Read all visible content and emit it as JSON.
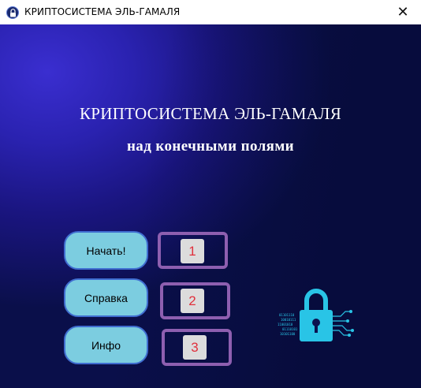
{
  "window": {
    "title": "КРИПТОСИСТЕМА ЭЛЬ-ГАМАЛЯ",
    "close_glyph": "✕",
    "icon": "lock-app-icon"
  },
  "header": {
    "title": "КРИПТОСИСТЕМА ЭЛЬ-ГАМАЛЯ",
    "subtitle": "над конечными полями"
  },
  "menu": {
    "buttons": [
      {
        "label": "Начать!",
        "step": "1"
      },
      {
        "label": "Справка",
        "step": "2"
      },
      {
        "label": "Инфо",
        "step": "3"
      }
    ]
  },
  "decoration": {
    "icon": "digital-padlock-icon",
    "colors": {
      "lock": "#29c4e6",
      "step_border": "#8e5fb0",
      "step_number": "#e0303c",
      "button_fill": "#7ccde0",
      "button_border": "#3f6dd0"
    }
  }
}
